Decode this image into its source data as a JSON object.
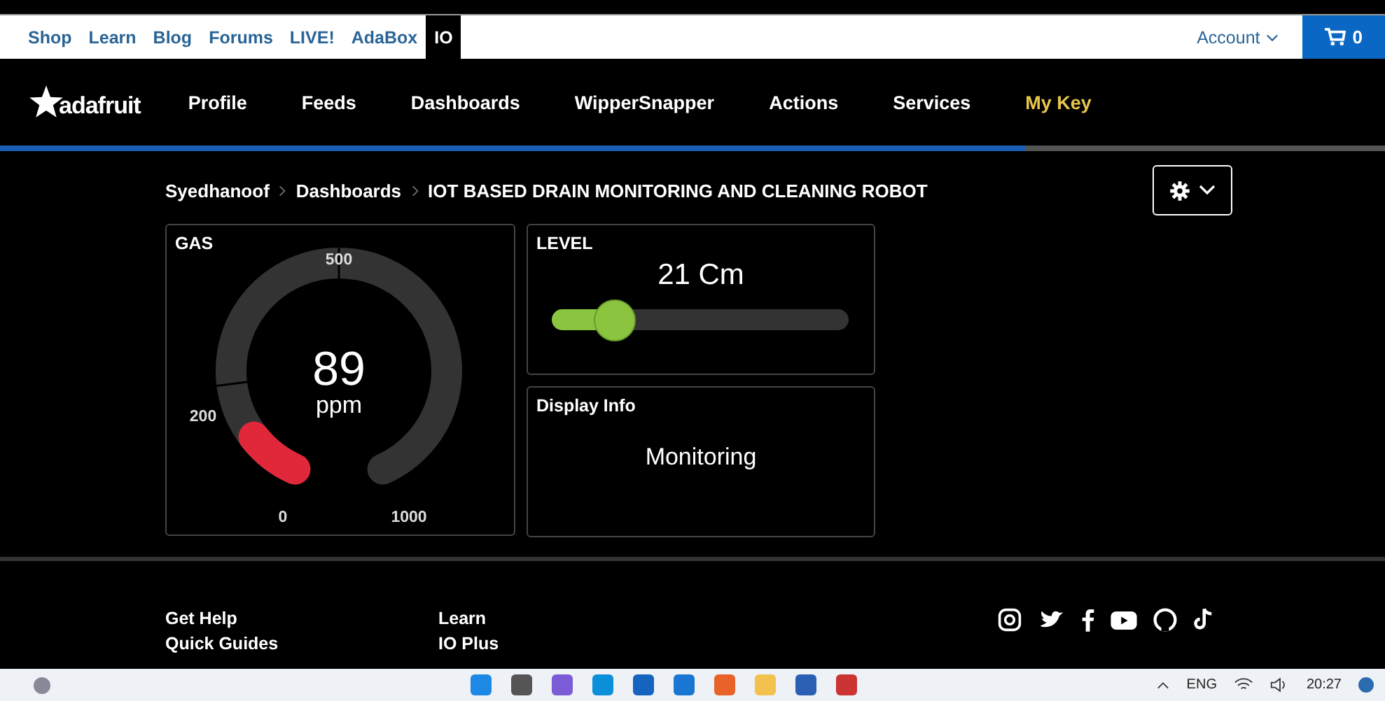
{
  "top_links": [
    {
      "label": "Shop",
      "selected": false
    },
    {
      "label": "Learn",
      "selected": false
    },
    {
      "label": "Blog",
      "selected": false
    },
    {
      "label": "Forums",
      "selected": false
    },
    {
      "label": "LIVE!",
      "selected": false
    },
    {
      "label": "AdaBox",
      "selected": false
    },
    {
      "label": "IO",
      "selected": true
    }
  ],
  "account": "Account",
  "cart_count": "0",
  "logo": "adafruit",
  "nav": [
    {
      "label": "Profile",
      "selected": false
    },
    {
      "label": "Feeds",
      "selected": false
    },
    {
      "label": "Dashboards",
      "selected": false
    },
    {
      "label": "WipperSnapper",
      "selected": false
    },
    {
      "label": "Actions",
      "selected": false
    },
    {
      "label": "Services",
      "selected": false
    },
    {
      "label": "My Key",
      "selected": true
    }
  ],
  "breadcrumb": [
    "Syedhanoof",
    "Dashboards",
    "IOT BASED DRAIN MONITORING AND CLEANING ROBOT"
  ],
  "gauge": {
    "title": "GAS",
    "value": "89",
    "unit": "ppm",
    "labels": [
      "0",
      "200",
      "500",
      "1000"
    ]
  },
  "slider": {
    "title": "LEVEL",
    "reading": "21 Cm",
    "level": 0.21
  },
  "text_block": {
    "title": "Display Info",
    "text": "Monitoring"
  },
  "footer": {
    "columns": [
      [
        "Get Help",
        "Quick Guides"
      ],
      [
        "Learn",
        "IO Plus"
      ]
    ]
  },
  "taskbar": {
    "language": "ENG",
    "time": "20:27"
  }
}
